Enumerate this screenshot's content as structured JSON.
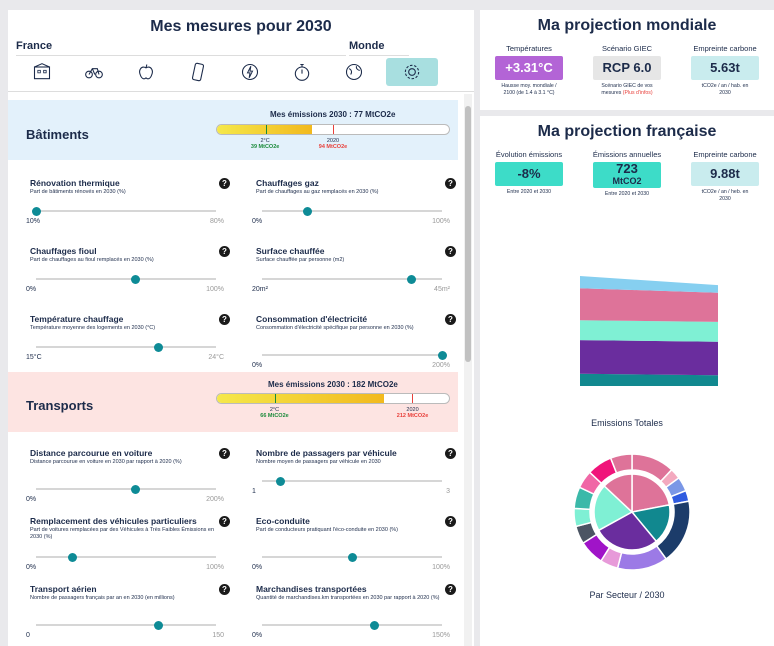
{
  "left_title": "Mes mesures pour 2030",
  "france_label": "France",
  "monde_label": "Monde",
  "icons": [
    "building-icon",
    "bike-icon",
    "apple-icon",
    "phone-icon",
    "energy-icon",
    "stopwatch-icon",
    "globe-icon",
    "settings-icon"
  ],
  "batiments": {
    "name": "Bâtiments",
    "emissions_title": "Mes émissions 2030 : 77 MtCO2e",
    "target_label": "2°C",
    "target_value": "39 MtCO2e",
    "ref_label": "2020",
    "ref_value": "94 MtCO2e",
    "fill_fraction": 0.41,
    "target_fraction": 0.21,
    "ref_fraction": 0.5,
    "color": "#e3f1fb"
  },
  "bat_controls": [
    {
      "title": "Rénovation thermique",
      "sub": "Part de bâtiments rénovés en 2030 (%)",
      "min": "10%",
      "max": "80%",
      "value": 0.0
    },
    {
      "title": "Chauffages gaz",
      "sub": "Part de chauffages au gaz remplacés en 2030 (%)",
      "min": "0%",
      "max": "100%",
      "value": 0.25
    },
    {
      "title": "Chauffages fioul",
      "sub": "Part de chauffages au fioul remplacés en 2030 (%)",
      "min": "0%",
      "max": "100%",
      "value": 0.55
    },
    {
      "title": "Surface chauffée",
      "sub": "Surface chauffée par personne (m2)",
      "min": "20m²",
      "max": "45m²",
      "value": 0.83
    },
    {
      "title": "Température chauffage",
      "sub": "Température moyenne des logements en 2030 (°C)",
      "min": "15°C",
      "max": "24°C",
      "value": 0.68
    },
    {
      "title": "Consommation d'électricité",
      "sub": "Consommation d'électricité spécifique par personne en 2030 (%)",
      "min": "0%",
      "max": "200%",
      "value": 1.0
    }
  ],
  "transports": {
    "name": "Transports",
    "emissions_title": "Mes émissions 2030 : 182 MtCO2e",
    "target_label": "2°C",
    "target_value": "66 MtCO2e",
    "ref_label": "2020",
    "ref_value": "212 MtCO2e",
    "fill_fraction": 0.72,
    "target_fraction": 0.25,
    "ref_fraction": 0.84,
    "color": "#fde4e2"
  },
  "trans_controls": [
    {
      "title": "Distance parcourue en voiture",
      "sub": "Distance parcourue en voiture en 2030 par rapport à 2020 (%)",
      "min": "0%",
      "max": "200%",
      "value": 0.55
    },
    {
      "title": "Nombre de passagers par véhicule",
      "sub": "Nombre moyen de passagers par véhicule en 2030",
      "min": "1",
      "max": "3",
      "value": 0.1
    },
    {
      "title": "Remplacement des véhicules particuliers",
      "sub": "Part de voitures remplacées par des Véhicules à Très Faibles Émissions en 2030 (%)",
      "min": "0%",
      "max": "100%",
      "value": 0.2
    },
    {
      "title": "Eco-conduite",
      "sub": "Part de conducteurs pratiquant l'éco-conduite en 2030 (%)",
      "min": "0%",
      "max": "100%",
      "value": 0.5
    },
    {
      "title": "Transport aérien",
      "sub": "Nombre de passagers français par an en 2030 (en millions)",
      "min": "0",
      "max": "150",
      "value": 0.68
    },
    {
      "title": "Marchandises transportées",
      "sub": "Quantité de marchandises.km transportées en 2030 par rapport à 2020 (%)",
      "min": "0%",
      "max": "150%",
      "value": 0.62
    }
  ],
  "mondiale": {
    "title": "Ma projection mondiale",
    "cards": [
      {
        "label": "Températures",
        "value": "+3.31°C",
        "cap1": "Hausse moy. mondiale /",
        "cap2": "2100 (de 1.4 à 3.1 °C)",
        "bg": "#b364d6",
        "fg": "#ffffff"
      },
      {
        "label": "Scénario GIEC",
        "value": "RCP 6.0",
        "cap1": "Scénario GIEC de vos",
        "cap2": "mesures",
        "cap_link": "(Plus d'infos)",
        "bg": "#e6e6e6",
        "fg": "#1c2b4a"
      },
      {
        "label": "Empreinte carbone",
        "value": "5.63t",
        "cap1": "tCO2e / an / hab. en",
        "cap2": "2030",
        "bg": "#c9ecee",
        "fg": "#1c2b4a"
      }
    ]
  },
  "francaise": {
    "title": "Ma projection française",
    "cards": [
      {
        "label": "Évolution émissions",
        "value": "-8%",
        "cap1": "Entre 2020 et 2030",
        "cap2": "",
        "bg": "#3ddcc8",
        "fg": "#1c2b4a"
      },
      {
        "label": "Émissions annuelles",
        "value": "723",
        "value2": "MtCO2",
        "cap1": "Entre 2020 et 2030",
        "cap2": "",
        "bg": "#3ddcc8",
        "fg": "#1c2b4a"
      },
      {
        "label": "Empreinte carbone",
        "value": "9.88t",
        "cap1": "tCO2e / an / heb. en",
        "cap2": "2030",
        "bg": "#c9ecee",
        "fg": "#1c2b4a"
      }
    ],
    "chart1_label": "Emissions Totales",
    "chart2_label": "Par Secteur / 2030"
  },
  "chart_data": [
    {
      "type": "area",
      "title": "Emissions Totales",
      "series": [
        {
          "values": [
            16,
            14
          ],
          "color": "#11888f"
        },
        {
          "values": [
            44,
            44
          ],
          "color": "#6a2d9e"
        },
        {
          "values": [
            26,
            26
          ],
          "color": "#7ff0d4"
        },
        {
          "values": [
            42,
            38
          ],
          "color": "#de7399"
        },
        {
          "values": [
            16,
            10
          ],
          "color": "#86cff0"
        }
      ]
    },
    {
      "type": "pie",
      "title": "Par Secteur / 2030",
      "inner": [
        {
          "value": 22,
          "color": "#de7399"
        },
        {
          "value": 17,
          "color": "#11888f"
        },
        {
          "value": 28,
          "color": "#6a2d9e"
        },
        {
          "value": 20,
          "color": "#7ff0d4"
        },
        {
          "value": 13,
          "color": "#de7399"
        }
      ],
      "outer": [
        {
          "value": 12,
          "color": "#de7399"
        },
        {
          "value": 3,
          "color": "#f3a9bf"
        },
        {
          "value": 4,
          "color": "#7a97e6"
        },
        {
          "value": 3,
          "color": "#2f5be0"
        },
        {
          "value": 18,
          "color": "#1c3c6a"
        },
        {
          "value": 14,
          "color": "#9c7ae6"
        },
        {
          "value": 5,
          "color": "#e79ad9"
        },
        {
          "value": 7,
          "color": "#a014c8"
        },
        {
          "value": 5,
          "color": "#4b5563"
        },
        {
          "value": 5,
          "color": "#7ff0d4"
        },
        {
          "value": 6,
          "color": "#3bb9a9"
        },
        {
          "value": 5,
          "color": "#f067a6"
        },
        {
          "value": 7,
          "color": "#f0147a"
        },
        {
          "value": 6,
          "color": "#de7399"
        }
      ]
    }
  ]
}
